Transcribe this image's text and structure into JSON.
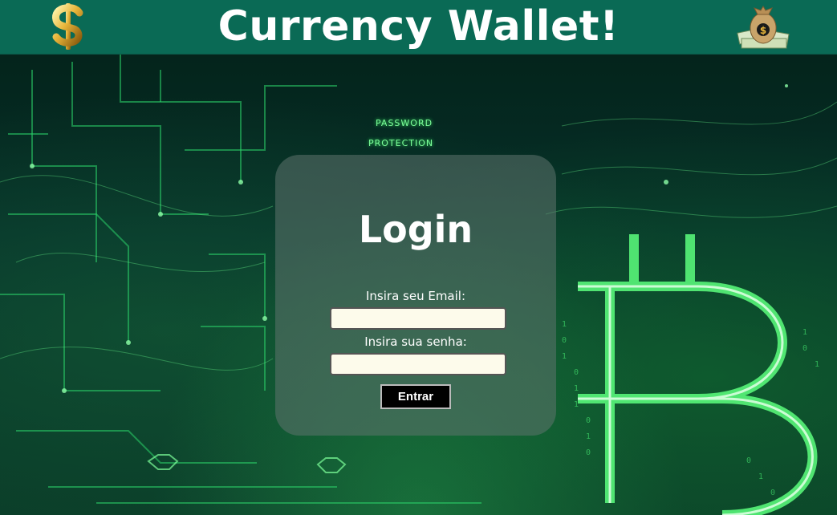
{
  "header": {
    "title": "Currency Wallet!",
    "left_icon": "dollar-sign-icon",
    "right_icon": "money-bag-icon",
    "background_color": "#0a6a55"
  },
  "background": {
    "overlay_texts": [
      "PASSWORD",
      "PROTECTION"
    ],
    "theme": "circuit-board-bitcoin",
    "accent_color": "#3dff6a"
  },
  "login": {
    "title": "Login",
    "email_label": "Insira seu Email:",
    "email_value": "",
    "password_label": "Insira sua senha:",
    "password_value": "",
    "submit_label": "Entrar"
  }
}
